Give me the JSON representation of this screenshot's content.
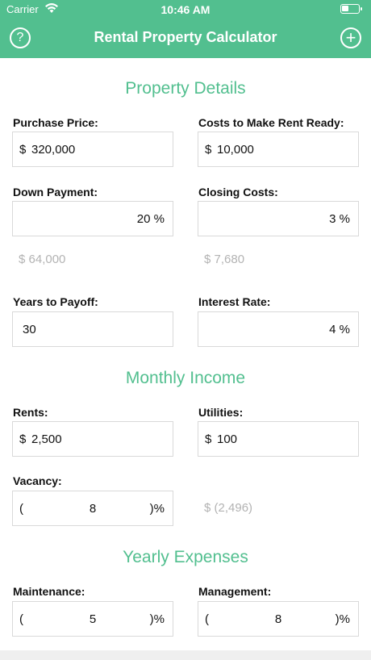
{
  "status": {
    "carrier": "Carrier",
    "time": "10:46 AM",
    "battery_level": 0.4
  },
  "nav": {
    "title": "Rental Property Calculator",
    "help_icon": "?",
    "add_icon": "+"
  },
  "sections": {
    "property": "Property Details",
    "income": "Monthly Income",
    "expenses": "Yearly Expenses"
  },
  "purchase_price": {
    "label": "Purchase Price:",
    "currency": "$",
    "value": "320,000"
  },
  "rent_ready": {
    "label": "Costs to Make Rent Ready:",
    "currency": "$",
    "value": "10,000"
  },
  "down_payment": {
    "label": "Down Payment:",
    "value": "20 %",
    "computed": "$ 64,000"
  },
  "closing_costs": {
    "label": "Closing Costs:",
    "value": "3 %",
    "computed": "$ 7,680"
  },
  "years_payoff": {
    "label": "Years to Payoff:",
    "value": "30"
  },
  "interest_rate": {
    "label": "Interest Rate:",
    "value": "4 %"
  },
  "rents": {
    "label": "Rents:",
    "currency": "$",
    "value": "2,500"
  },
  "utilities": {
    "label": "Utilities:",
    "currency": "$",
    "value": "100"
  },
  "vacancy": {
    "label": "Vacancy:",
    "open": "(",
    "value": "8",
    "close": ")%",
    "computed": "$ (2,496)"
  },
  "maintenance": {
    "label": "Maintenance:",
    "open": "(",
    "value": "5",
    "close": ")%"
  },
  "management": {
    "label": "Management:",
    "open": "(",
    "value": "8",
    "close": ")%"
  }
}
